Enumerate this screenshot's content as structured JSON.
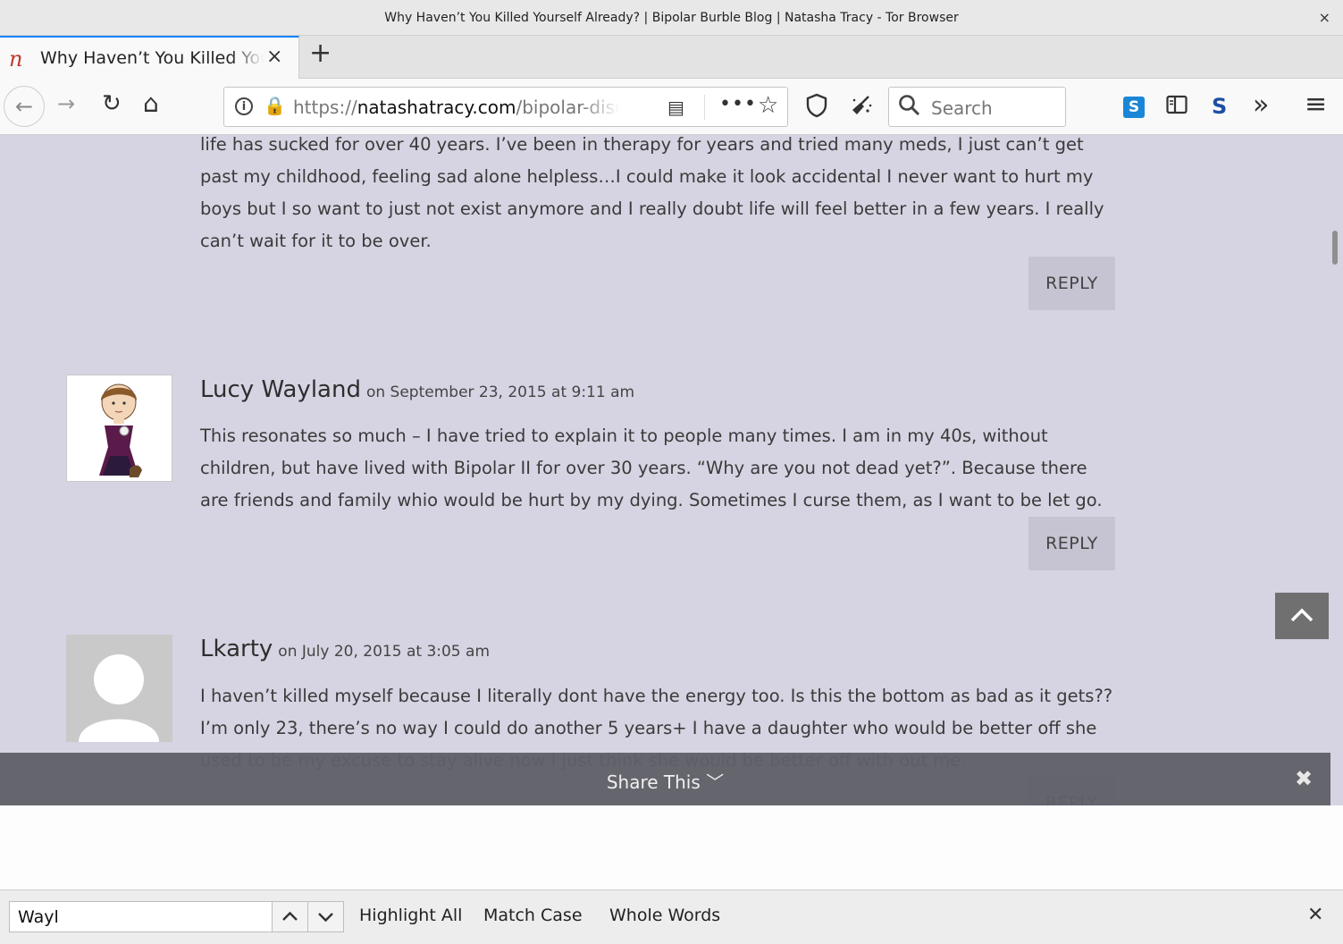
{
  "window": {
    "title": "Why Haven’t You Killed Yourself Already? | Bipolar Burble Blog | Natasha Tracy - Tor Browser",
    "close_symbol": "×"
  },
  "tab": {
    "favicon": "n",
    "title": "Why Haven’t You Killed Yourself Already?",
    "close_symbol": "×",
    "new_tab_symbol": "+"
  },
  "nav": {
    "back_symbol": "←",
    "forward_symbol": "→",
    "reload_symbol": "↻",
    "home_symbol": "⌂",
    "info_symbol": "i",
    "lock_symbol": "🔒",
    "url_scheme": "https://",
    "url_host": "natashatracy.com",
    "url_path": "/bipolar-disorder",
    "reader_symbol": "▤",
    "more_symbol": "•••",
    "bookmark_symbol": "☆",
    "search_placeholder": "Search",
    "overflow_symbol": "»",
    "menu_symbol": "≡",
    "ext_s_label": "S",
    "ext_s2_label": "S"
  },
  "comments": {
    "prev_text": "life has sucked for over 40 years. I’ve been in therapy for years and tried many meds, I just can’t get past my childhood, feeling sad alone helpless…I could make it look accidental I never want to hurt my boys but I so want to just not exist anymore and I really doubt life will feel better in a few years. I really can’t wait for it to be over.",
    "reply_label": "REPLY",
    "items": [
      {
        "author": "Lucy Wayland",
        "date": "on September 23, 2015 at 9:11 am",
        "text": "This resonates so much – I have tried to explain it to people many times. I am in my 40s, without children, but have lived with Bipolar II for over 30 years. “Why are you not dead yet?”. Because there are friends and family whio would be hurt by my dying. Sometimes I curse them, as I want to be let go."
      },
      {
        "author": "Lkarty",
        "date": "on July 20, 2015 at 3:05 am",
        "text": "I haven’t killed myself because I literally dont have the energy too. Is this the bottom as bad as it gets?? I’m only 23, there’s no way I could do another 5 years+ I have a daughter who would be better off she used to be my excuse to stay alive now I just think she would be better off with out me."
      }
    ]
  },
  "share": {
    "label": "Share This",
    "chevron": "﹀",
    "close_symbol": "✖"
  },
  "findbar": {
    "value": "Wayl",
    "prev_symbol": "⌃",
    "next_symbol": "⌄",
    "highlight_all": "Highlight All",
    "match_case": "Match Case",
    "whole_words": "Whole Words",
    "close_symbol": "✕"
  },
  "colors": {
    "content_bg": "#d6d4e2",
    "reply_bg": "#c6c4d2",
    "share_bar": "#606068",
    "tab_accent": "#0a84ff",
    "lock_green": "#12bc00"
  }
}
